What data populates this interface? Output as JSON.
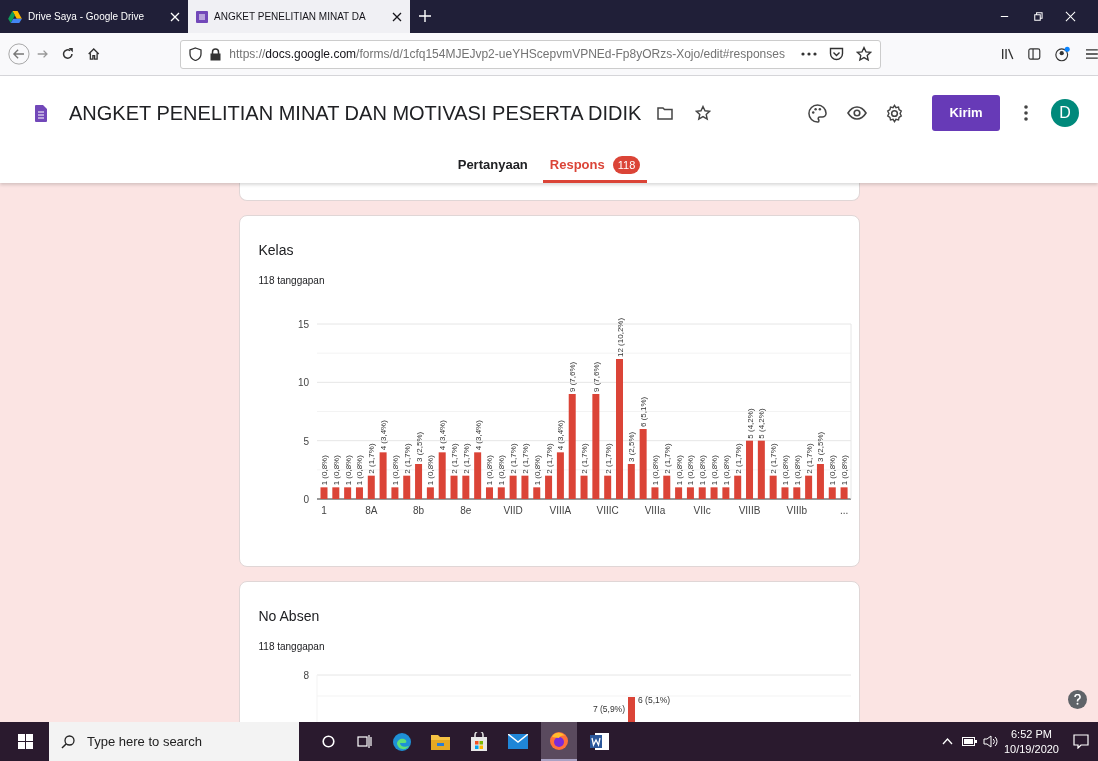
{
  "browser": {
    "tabs": [
      {
        "title": "Drive Saya - Google Drive",
        "selected": false,
        "kind": "drive"
      },
      {
        "title": "ANGKET PENELITIAN MINAT DA",
        "selected": true,
        "kind": "forms"
      }
    ],
    "url": "https://**docs.google.com**/forms/d/1cfq154MJEJvp2-ueYHScepvmVPNEd-Fp8yORzs-Xojo/edit#responses"
  },
  "form": {
    "title": "ANGKET PENELITIAN MINAT DAN MOTIVASI PESERTA DIDIK",
    "send_button": "Kirim",
    "avatar": "D",
    "tabs": [
      {
        "label": "Pertanyaan",
        "selected": false
      },
      {
        "label": "Respons",
        "selected": true,
        "badge": "118"
      }
    ]
  },
  "questions": [
    {
      "kind": "bar_chart",
      "title": "Kelas",
      "count": "118 tanggapan",
      "chart_data": {
        "type": "bar",
        "ylim": [
          0,
          15
        ],
        "yticks": [
          0,
          5,
          10,
          15
        ],
        "categories": [
          "1",
          null,
          null,
          null,
          "8A",
          null,
          null,
          null,
          "8b",
          null,
          null,
          null,
          "8e",
          null,
          null,
          null,
          "VIID",
          null,
          null,
          null,
          "VIIIA",
          null,
          null,
          null,
          "VIIIC",
          null,
          null,
          null,
          "VIIIa",
          null,
          null,
          null,
          "VIIc",
          null,
          null,
          null,
          "VIIIB",
          null,
          null,
          null,
          "VIIIb",
          null,
          null,
          null,
          "..."
        ],
        "values": [
          1,
          1,
          1,
          1,
          2,
          4,
          1,
          2,
          3,
          1,
          4,
          2,
          2,
          4,
          1,
          1,
          2,
          2,
          1,
          2,
          4,
          9,
          2,
          9,
          2,
          12,
          3,
          6,
          1,
          2,
          1,
          1,
          1,
          1,
          1,
          2,
          5,
          5,
          2,
          1,
          1,
          2,
          3,
          1,
          1
        ],
        "value_labels": [
          "1 (0,8%)",
          "1 (0,8%)",
          "1 (0,8%)",
          "1 (0,8%)",
          "2 (1,7%)",
          "4 (3,4%)",
          "1 (0,8%)",
          "2 (1,7%)",
          "3 (2,5%)",
          "1 (0,8%)",
          "4 (3,4%)",
          "2 (1,7%)",
          "2 (1,7%)",
          "4 (3,4%)",
          "1 (0,8%)",
          "1 (0,8%)",
          "2 (1,7%)",
          "2 (1,7%)",
          "1 (0,8%)",
          "2 (1,7%)",
          "4 (3,4%)",
          "9 (7,6%)",
          "2 (1,7%)",
          "9 (7,6%)",
          "2 (1,7%)",
          "12 (10,2%)",
          "3 (2,5%)",
          "6 (5,1%)",
          "1 (0,8%)",
          "2 (1,7%)",
          "1 (0,8%)",
          "1 (0,8%)",
          "1 (0,8%)",
          "1 (0,8%)",
          "1 (0,8%)",
          "2 (1,7%)",
          "5 (4,2%)",
          "5 (4,2%)",
          "2 (1,7%)",
          "1 (0,8%)",
          "1 (0,8%)",
          "2 (1,7%)",
          "3 (2,5%)",
          "1 (0,8%)",
          "1 (0,8%)"
        ]
      }
    },
    {
      "kind": "cut_chart",
      "title": "No Absen",
      "count": "118 tanggapan",
      "axis_label": "8",
      "bar_labels": [
        "6 (5,1%)",
        "7 (5,9%)"
      ]
    }
  ],
  "taskbar": {
    "search_placeholder": "Type here to search",
    "time": "6:52 PM",
    "date": "10/19/2020"
  }
}
